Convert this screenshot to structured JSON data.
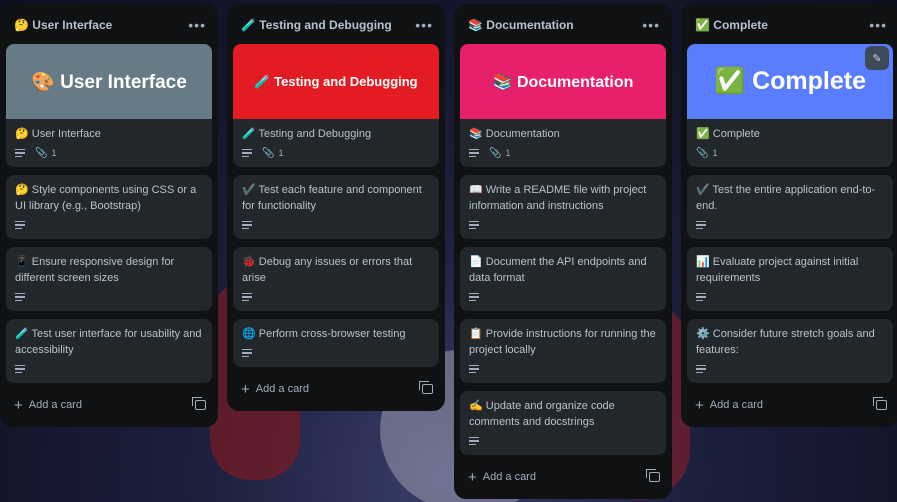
{
  "lists": [
    {
      "title": "🤔 User Interface",
      "cards": [
        {
          "cover": "🎨 User Interface",
          "cover_color": "#667b85",
          "title": "🤔 User Interface",
          "desc": true,
          "attachments": "1"
        },
        {
          "title": "🤔 Style components using CSS or a UI library (e.g., Bootstrap)",
          "desc": true
        },
        {
          "title": "📱 Ensure responsive design for different screen sizes",
          "desc": true
        },
        {
          "title": "🧪 Test user interface for usability and accessibility",
          "desc": true
        }
      ],
      "add_label": "Add a card"
    },
    {
      "title": "🧪 Testing and Debugging",
      "cards": [
        {
          "cover": "🧪 Testing and Debugging",
          "cover_color": "#e31b23",
          "title": "🧪 Testing and Debugging",
          "desc": true,
          "attachments": "1"
        },
        {
          "title": "✔️ Test each feature and component for functionality",
          "desc": true
        },
        {
          "title": "🐞 Debug any issues or errors that arise",
          "desc": true
        },
        {
          "title": "🌐 Perform cross-browser testing",
          "desc": true
        }
      ],
      "add_label": "Add a card"
    },
    {
      "title": "📚 Documentation",
      "cards": [
        {
          "cover": "📚 Documentation",
          "cover_color": "#e6206a",
          "title": "📚 Documentation",
          "desc": true,
          "attachments": "1"
        },
        {
          "title": "📖 Write a README file with project information and instructions",
          "desc": true
        },
        {
          "title": "📄 Document the API endpoints and data format",
          "desc": true
        },
        {
          "title": "📋 Provide instructions for running the project locally",
          "desc": true
        },
        {
          "title": "✍️ Update and organize code comments and docstrings",
          "desc": true
        }
      ],
      "add_label": "Add a card"
    },
    {
      "title": "✅ Complete",
      "cards": [
        {
          "cover": "✅ Complete",
          "cover_color": "#5a7cff",
          "title": "✅ Complete",
          "desc": false,
          "attachments": "1"
        },
        {
          "title": "✔️ Test the entire application end-to-end.",
          "desc": true
        },
        {
          "title": "📊 Evaluate project against initial requirements",
          "desc": true
        },
        {
          "title": "⚙️ Consider future stretch goals and features:",
          "desc": true
        }
      ],
      "add_label": "Add a card"
    }
  ],
  "icons": {
    "more": "ellipsis-icon",
    "add": "plus-icon",
    "template": "card-template-icon",
    "edit": "pencil-icon"
  }
}
